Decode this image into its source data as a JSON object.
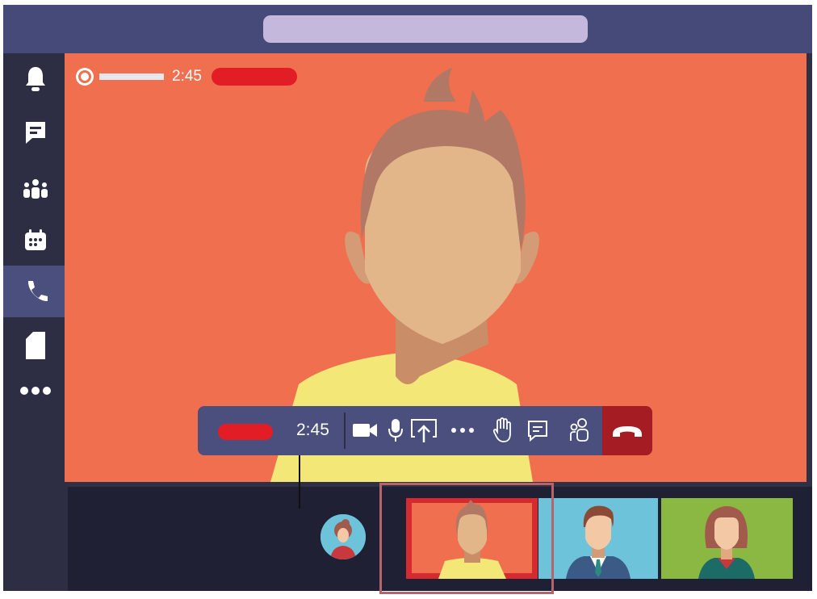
{
  "app": {
    "search_placeholder": ""
  },
  "rail": {
    "items": [
      {
        "name": "activity",
        "icon": "bell-icon"
      },
      {
        "name": "chat",
        "icon": "chat-icon"
      },
      {
        "name": "teams",
        "icon": "people-icon"
      },
      {
        "name": "calendar",
        "icon": "calendar-icon"
      },
      {
        "name": "calls",
        "icon": "phone-icon",
        "active": true
      },
      {
        "name": "files",
        "icon": "file-icon"
      },
      {
        "name": "more",
        "icon": "more-icon"
      }
    ]
  },
  "meeting": {
    "recording_time": "2:45",
    "call_time": "2:45",
    "recording_indicator_color": "#e21d25"
  },
  "controls": {
    "buttons": [
      "camera-icon",
      "microphone-icon",
      "share-screen-icon",
      "more-options-icon",
      "raise-hand-icon",
      "chat-icon",
      "participants-icon",
      "hang-up-icon"
    ]
  },
  "colors": {
    "stage": "#ef6f4e",
    "toolbar": "#4a4f7e",
    "hangup": "#a51c23",
    "rail": "#2d2e43",
    "titlebar": "#454a78"
  }
}
